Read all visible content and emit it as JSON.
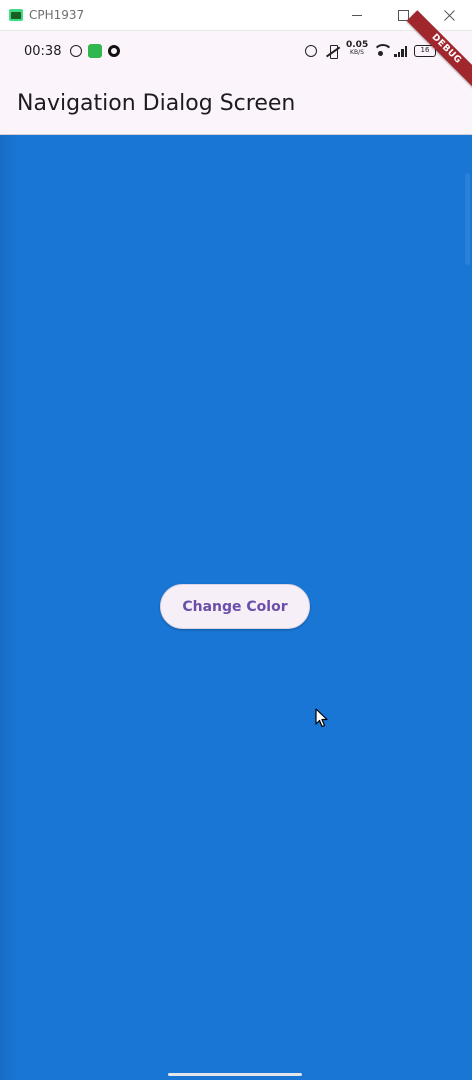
{
  "window": {
    "title": "CPH1937"
  },
  "status_bar": {
    "time": "00:38",
    "net_speed_value": "0.05",
    "net_speed_unit": "KB/S",
    "battery_level": "16",
    "left_icons": [
      "whatsapp-icon",
      "green-app-icon",
      "target-icon"
    ],
    "right_icons": [
      "alarm-icon",
      "vibrate-icon",
      "wifi-icon",
      "signal-icon",
      "battery-icon"
    ]
  },
  "debug_banner": "DEBUG",
  "app_bar": {
    "title": "Navigation Dialog Screen"
  },
  "body": {
    "background_color": "#1976d5",
    "button_label": "Change Color"
  }
}
